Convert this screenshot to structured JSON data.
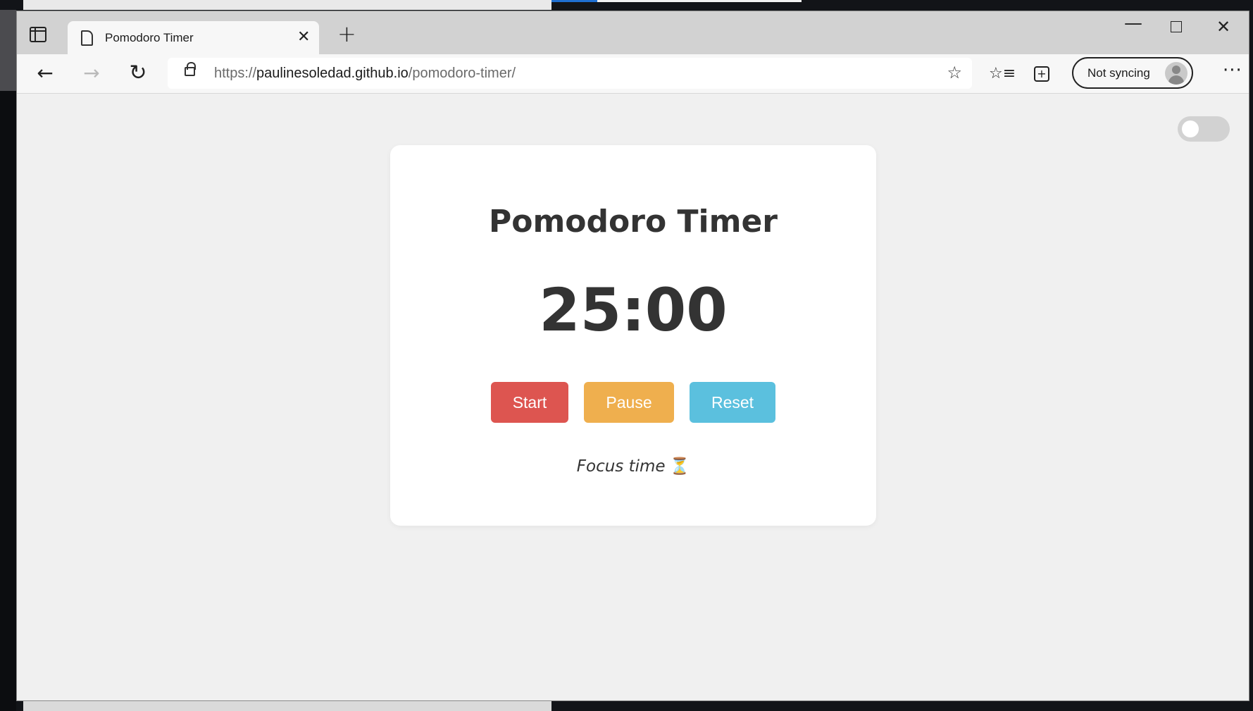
{
  "browser": {
    "tab_title": "Pomodoro Timer",
    "url_scheme": "https://",
    "url_host": "paulinesoledad.github.io",
    "url_path": "/pomodoro-timer/",
    "sync_label": "Not syncing"
  },
  "icons": {
    "sidebar": "sidebar-toggle-icon",
    "page": "document-icon",
    "close": "close-icon",
    "new_tab": "plus-icon",
    "back": "arrow-left-icon",
    "forward": "arrow-right-icon",
    "reload": "reload-icon",
    "lock": "lock-icon",
    "favorite_add": "star-plus-icon",
    "favorites": "favorites-icon",
    "collections": "collections-icon",
    "profile": "avatar-icon",
    "more": "ellipsis-icon",
    "hourglass": "hourglass-icon"
  },
  "app": {
    "title": "Pomodoro Timer",
    "time": "25:00",
    "buttons": {
      "start": "Start",
      "pause": "Pause",
      "reset": "Reset"
    },
    "status": "Focus time",
    "dark_mode_on": false
  },
  "colors": {
    "start": "#dd5550",
    "pause": "#efaf4e",
    "reset": "#5bc0de",
    "page_bg": "#f0f0f0",
    "card_bg": "#ffffff",
    "text": "#333333"
  }
}
